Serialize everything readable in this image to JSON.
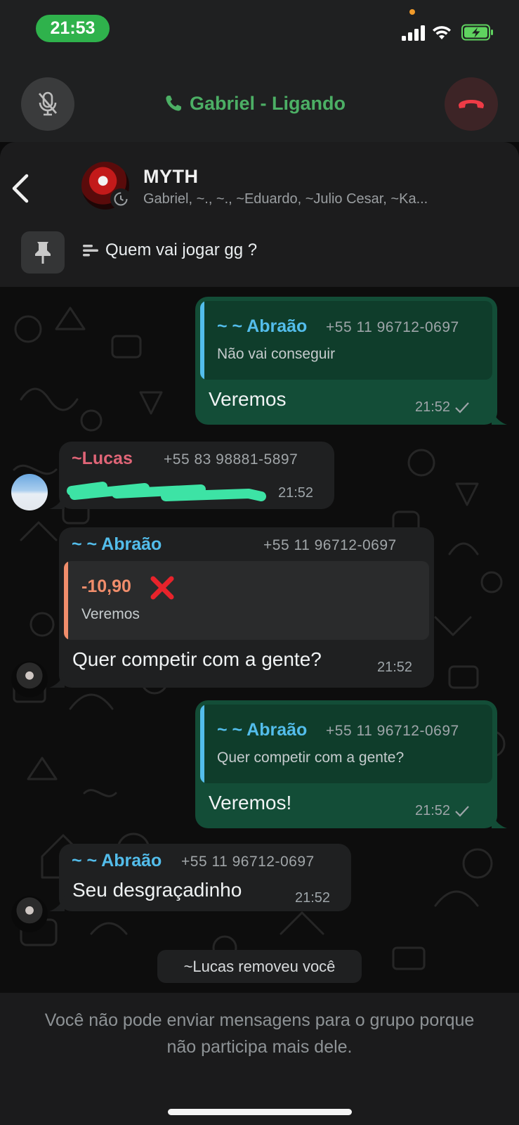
{
  "status_bar": {
    "time": "21:53"
  },
  "call": {
    "title": "Gabriel - Ligando"
  },
  "header": {
    "group_name": "MYTH",
    "members": "Gabriel, ~., ~., ~Eduardo, ~Julio Cesar, ~Ka...",
    "pinned_message": "Quem vai jogar gg ?"
  },
  "messages": [
    {
      "direction": "out",
      "quote_author": "~ ~ Abraão",
      "quote_phone": "+55 11 96712-0697",
      "quote_text": "Não vai conseguir",
      "text": "Veremos",
      "time": "21:52"
    },
    {
      "direction": "in",
      "sender": "~Lucas",
      "sender_phone": "+55 83 98881-5897",
      "text": "",
      "time": "21:52"
    },
    {
      "direction": "in",
      "sender": "~ ~ Abraão",
      "sender_phone": "+55 11 96712-0697",
      "quote_text": "-10,90",
      "quote_sub": "Veremos",
      "text": "Quer competir com a gente?",
      "time": "21:52"
    },
    {
      "direction": "out",
      "quote_author": "~ ~ Abraão",
      "quote_phone": "+55 11 96712-0697",
      "quote_text": "Quer competir com a gente?",
      "text": "Veremos!",
      "time": "21:52"
    },
    {
      "direction": "in",
      "sender": "~ ~ Abraão",
      "sender_phone": "+55 11 96712-0697",
      "text": "Seu desgraçadinho",
      "time": "21:52"
    }
  ],
  "system_note": "~Lucas removeu você",
  "footer": {
    "notice": "Você não pode enviar mensagens para o grupo porque não participa mais dele."
  },
  "colors": {
    "accent_green": "#4caf65",
    "out_bubble": "#134d37",
    "in_bubble": "#1f2021",
    "quote_blue": "#53bdeb",
    "lucas_pink": "#e06577",
    "quote_orange": "#f08d6b"
  },
  "icons": [
    "microphone-off-icon",
    "phone-icon",
    "end-call-icon",
    "back-icon",
    "pin-icon",
    "pinned-list-icon",
    "check-icon",
    "cross-mark-icon"
  ]
}
